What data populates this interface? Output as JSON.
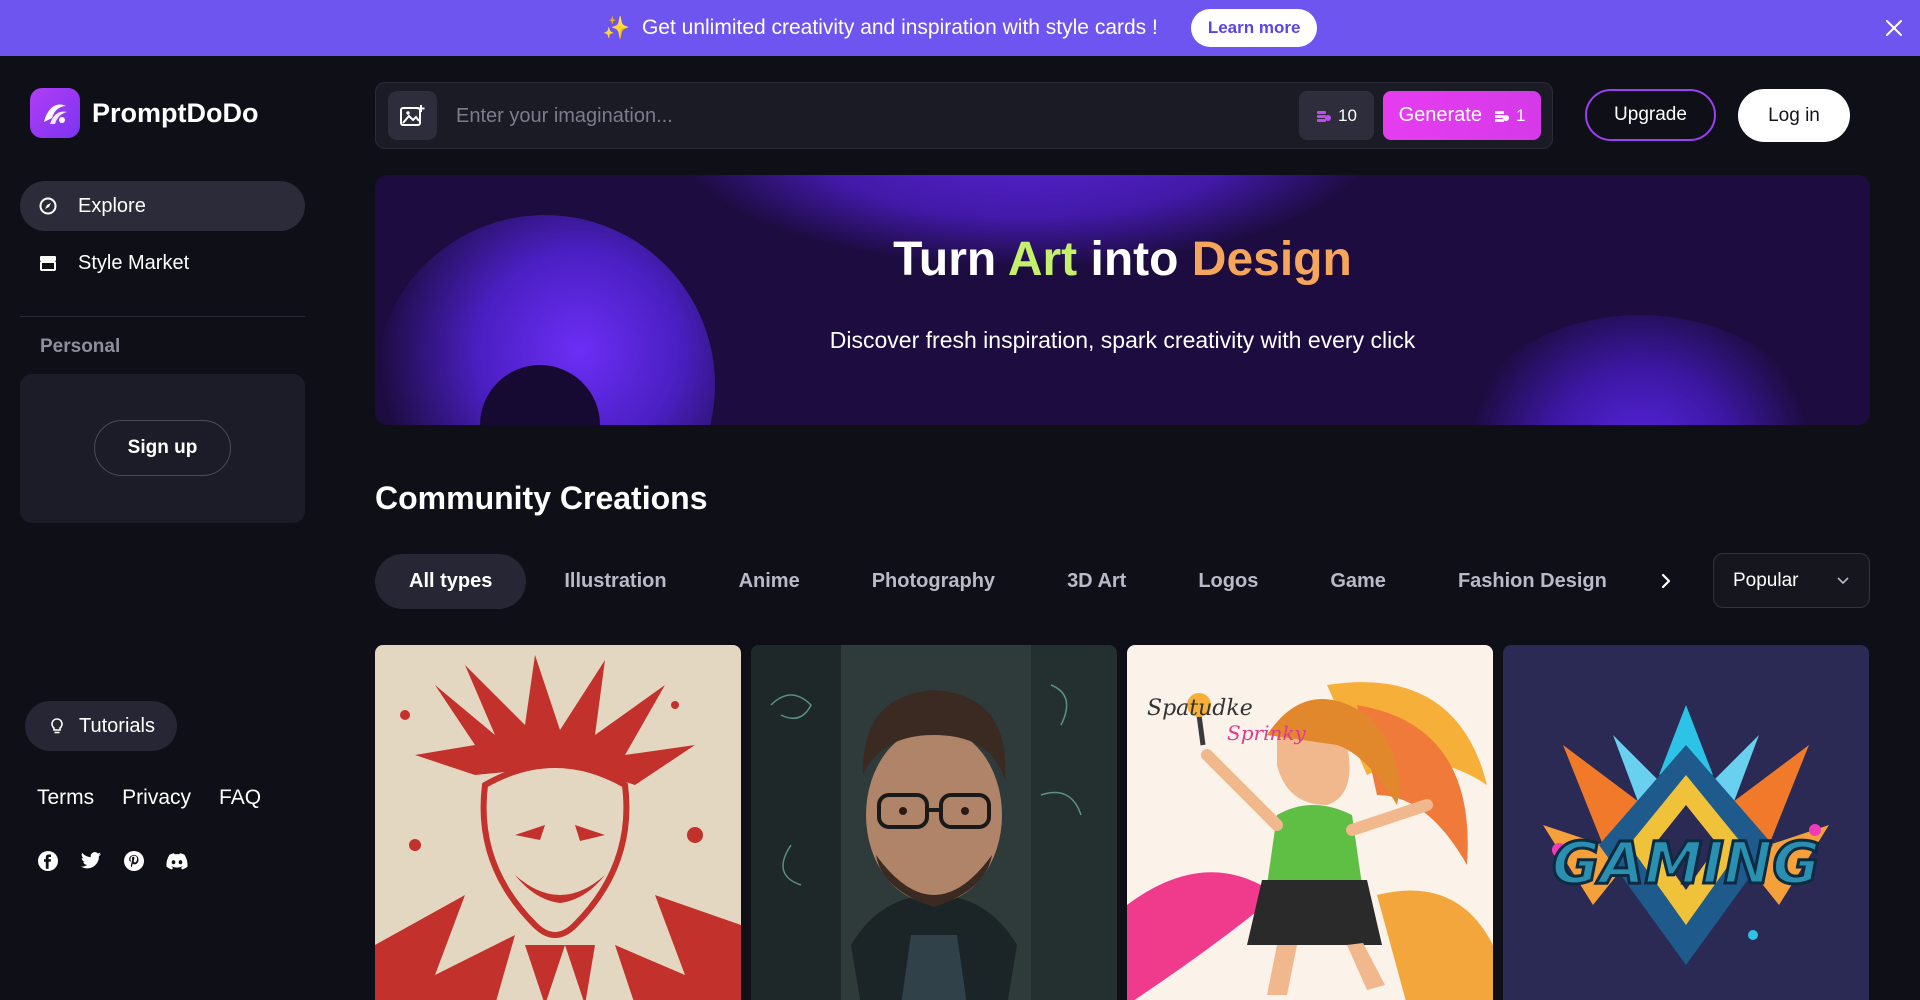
{
  "promo": {
    "sparkle": "✨",
    "text": "Get unlimited creativity and inspiration with style cards !",
    "learn_more": "Learn more"
  },
  "brand": {
    "name": "PromptDoDo"
  },
  "nav": [
    {
      "label": "Explore",
      "icon": "compass-icon",
      "active": true
    },
    {
      "label": "Style Market",
      "icon": "store-icon",
      "active": false
    }
  ],
  "personal": {
    "label": "Personal",
    "signup": "Sign up"
  },
  "tutorials": "Tutorials",
  "footer_links": [
    "Terms",
    "Privacy",
    "FAQ"
  ],
  "socials": [
    "facebook-icon",
    "twitter-icon",
    "pinterest-icon",
    "discord-icon"
  ],
  "search": {
    "placeholder": "Enter your imagination...",
    "credits": "10",
    "generate_label": "Generate",
    "generate_cost": "1"
  },
  "header": {
    "upgrade": "Upgrade",
    "login": "Log in"
  },
  "hero": {
    "title_1": "Turn ",
    "title_art": "Art",
    "title_2": " into ",
    "title_design": "Design",
    "subtitle": "Discover fresh inspiration, spark creativity with every click"
  },
  "community": {
    "title": "Community Creations",
    "filters": [
      "All types",
      "Illustration",
      "Anime",
      "Photography",
      "3D Art",
      "Logos",
      "Game",
      "Fashion Design"
    ],
    "active_filter": "All types",
    "sort": "Popular"
  },
  "colors": {
    "promo_bg": "#6e55f0",
    "accent_magenta": "#e63cf0",
    "accent_purple": "#9b3ff2",
    "art_green": "#c5f06b",
    "design_orange": "#f5a65a"
  }
}
